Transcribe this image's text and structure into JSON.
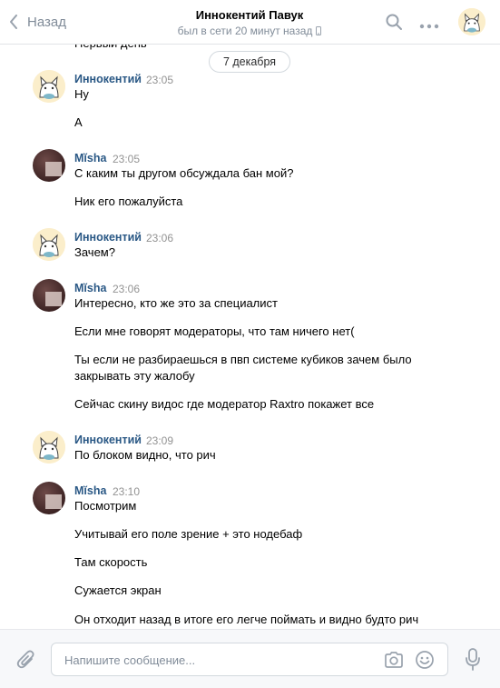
{
  "header": {
    "back_label": "Назад",
    "title": "Иннокентий Павук",
    "status": "был в сети 20 минут назад"
  },
  "clipped_text": "Первый день",
  "date_separator": "7 декабря",
  "messages": [
    {
      "author": "Иннокентий",
      "time": "23:05",
      "lines": [
        "Ну",
        "А"
      ]
    },
    {
      "author": "Mĭsha",
      "time": "23:05",
      "lines": [
        "С каким ты другом обсуждала бан мой?",
        "Ник его пожалуйста"
      ]
    },
    {
      "author": "Иннокентий",
      "time": "23:06",
      "lines": [
        "Зачем?"
      ]
    },
    {
      "author": "Mĭsha",
      "time": "23:06",
      "lines": [
        "Интересно, кто же это за специалист",
        "Если мне говорят модераторы, что там ничего нет(",
        "Ты если не разбираешься в пвп системе кубиков зачем было закрывать эту жалобу",
        "Сейчас скину видос где модератор Raxtro покажет все"
      ]
    },
    {
      "author": "Иннокентий",
      "time": "23:09",
      "lines": [
        "По блоком видно, что рич"
      ]
    },
    {
      "author": "Mĭsha",
      "time": "23:10",
      "lines": [
        "Посмотрим",
        "Учитывай его поле зрение + это нодебаф",
        "Там скорость",
        "Сужается экран",
        "Он отходит назад в итоге его легче поймать и видно будто рич"
      ]
    }
  ],
  "composer": {
    "placeholder": "Напишите сообщение...",
    "value": ""
  },
  "icons": {
    "back": "chevron-left-icon",
    "search": "search-icon",
    "more": "more-horizontal-icon",
    "attach": "paperclip-icon",
    "camera": "camera-icon",
    "emoji": "smile-icon",
    "microphone": "microphone-icon",
    "mobile": "mobile-phone-icon"
  },
  "colors": {
    "link_blue": "#2a5885",
    "muted_gray": "#818c99",
    "time_gray": "#939393",
    "background": "#ffffff",
    "composer_bg": "#f7f8fa"
  }
}
